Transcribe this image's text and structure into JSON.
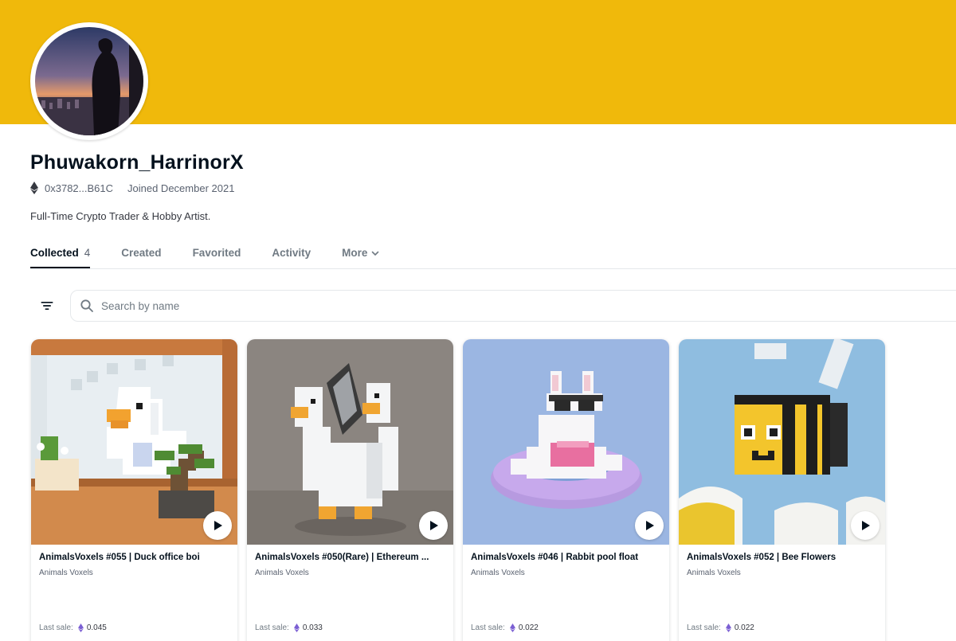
{
  "colors": {
    "banner": "#f0b90b",
    "text_primary": "#04111d",
    "text_secondary": "#707a83",
    "divider": "#e5e8eb",
    "eth_purple": "#7b5fd3"
  },
  "profile": {
    "avatar_icon": "profile-avatar",
    "name": "Phuwakorn_HarrinorX",
    "address_icon": "ethereum-icon",
    "address": "0x3782...B61C",
    "joined": "Joined December 2021",
    "bio": "Full-Time Crypto Trader & Hobby Artist."
  },
  "tabs": [
    {
      "label": "Collected",
      "count": "4",
      "active": true
    },
    {
      "label": "Created"
    },
    {
      "label": "Favorited"
    },
    {
      "label": "Activity"
    },
    {
      "label": "More",
      "icon": "chevron-down-icon"
    }
  ],
  "toolbar": {
    "filter_icon": "filter-icon",
    "search_icon": "search-icon",
    "search_placeholder": "Search by name",
    "search_value": ""
  },
  "items": [
    {
      "title": "AnimalsVoxels #055 | Duck office boi",
      "collection": "Animals Voxels",
      "last_sale_label": "Last sale:",
      "price": "0.045"
    },
    {
      "title": "AnimalsVoxels #050(Rare) | Ethereum ...",
      "collection": "Animals Voxels",
      "last_sale_label": "Last sale:",
      "price": "0.033"
    },
    {
      "title": "AnimalsVoxels #046 | Rabbit pool float",
      "collection": "Animals Voxels",
      "last_sale_label": "Last sale:",
      "price": "0.022"
    },
    {
      "title": "AnimalsVoxels #052 | Bee Flowers",
      "collection": "Animals Voxels",
      "last_sale_label": "Last sale:",
      "price": "0.022"
    }
  ]
}
